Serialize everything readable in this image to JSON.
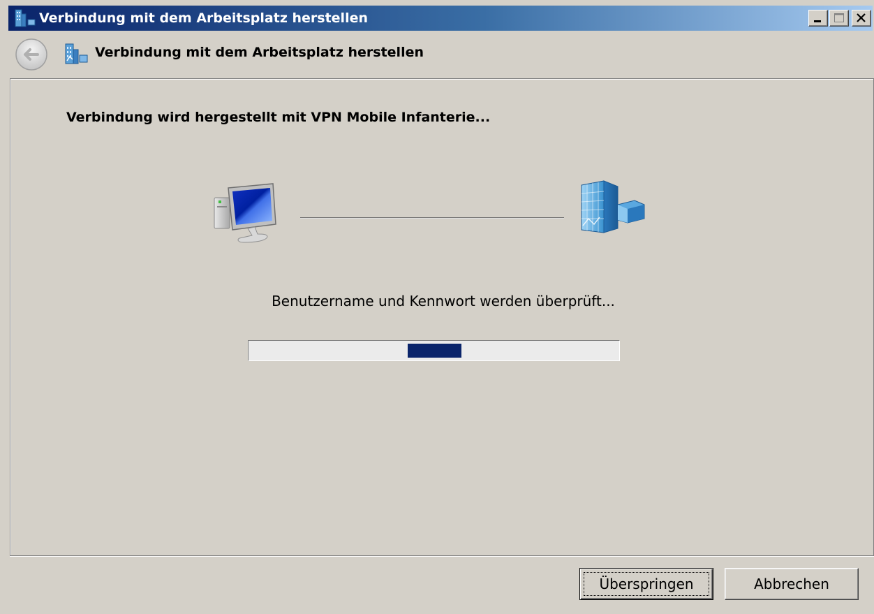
{
  "window": {
    "title": "Verbindung mit dem Arbeitsplatz herstellen"
  },
  "header": {
    "title": "Verbindung mit dem Arbeitsplatz herstellen",
    "back_icon": "back-arrow-icon",
    "app_icon": "workplace-connection-icon"
  },
  "content": {
    "status_heading": "Verbindung wird hergestellt mit VPN Mobile Infanterie...",
    "progress_text": "Benutzername und Kennwort werden überprüft...",
    "left_icon": "computer-icon",
    "right_icon": "office-building-icon",
    "progress": {
      "mode": "marquee",
      "chunk_start_fraction": 0.43,
      "chunk_length_fraction": 0.145,
      "color": "#0a246a"
    }
  },
  "footer": {
    "skip_label": "Überspringen",
    "cancel_label": "Abbrechen"
  },
  "colors": {
    "title_bar_start": "#0a246a",
    "title_bar_end": "#a6caf0",
    "face": "#d4d0c8"
  }
}
